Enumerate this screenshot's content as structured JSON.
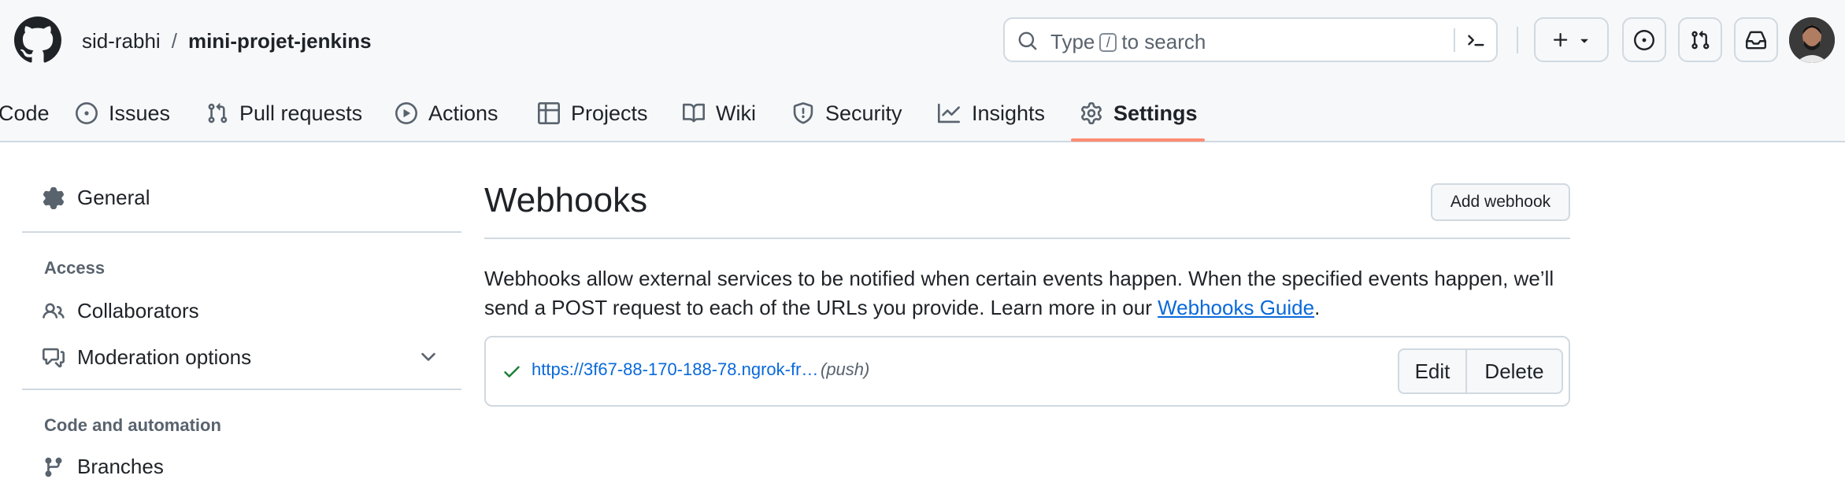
{
  "header": {
    "owner": "sid-rabhi",
    "separator": "/",
    "repo": "mini-projet-jenkins",
    "search": {
      "prefix": "Type",
      "key": "/",
      "suffix": "to search"
    },
    "icons": [
      "github-logo-icon",
      "search-icon",
      "command-palette-icon",
      "plus-icon",
      "issue-icon",
      "pull-request-icon",
      "inbox-icon"
    ]
  },
  "tabs": [
    {
      "label": "Code",
      "icon": "code-icon"
    },
    {
      "label": "Issues",
      "icon": "issue-opened-icon"
    },
    {
      "label": "Pull requests",
      "icon": "git-pull-request-icon"
    },
    {
      "label": "Actions",
      "icon": "play-icon"
    },
    {
      "label": "Projects",
      "icon": "table-icon"
    },
    {
      "label": "Wiki",
      "icon": "book-icon"
    },
    {
      "label": "Security",
      "icon": "shield-icon"
    },
    {
      "label": "Insights",
      "icon": "graph-icon"
    },
    {
      "label": "Settings",
      "icon": "gear-icon",
      "selected": true
    }
  ],
  "sidebar": {
    "general": "General",
    "access_heading": "Access",
    "collaborators": "Collaborators",
    "moderation": "Moderation options",
    "code_heading": "Code and automation",
    "branches": "Branches"
  },
  "main": {
    "title": "Webhooks",
    "add_button": "Add webhook",
    "description": "Webhooks allow external services to be notified when certain events happen. When the specified events happen, we’ll send a POST request to each of the URLs you provide. Learn more in our ",
    "guide_link": "Webhooks Guide",
    "description_end": ".",
    "webhooks": [
      {
        "url": "https://3f67-88-170-188-78.ngrok-fr…",
        "event": "(push)",
        "status": "success",
        "edit_label": "Edit",
        "delete_label": "Delete"
      }
    ]
  },
  "colors": {
    "accent": "#0969da",
    "tab_underline": "#fd8c73",
    "success": "#1a7f37",
    "border": "#d1d9e0"
  }
}
